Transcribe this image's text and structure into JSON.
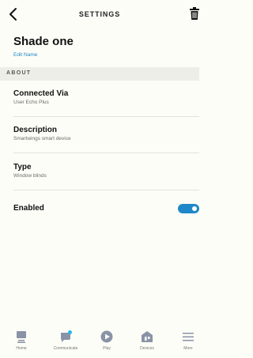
{
  "header": {
    "title": "SETTINGS",
    "back_icon": "back-arrow-icon",
    "delete_icon": "trash-icon"
  },
  "device": {
    "name": "Shade one",
    "edit_label": "Edit Name"
  },
  "section": {
    "title": "ABOUT"
  },
  "rows": [
    {
      "label": "Connected Via",
      "value": "User Echo Plus"
    },
    {
      "label": "Description",
      "value": "Smartwings smart device"
    },
    {
      "label": "Type",
      "value": "Window blinds"
    }
  ],
  "enabled": {
    "label": "Enabled",
    "on": true
  },
  "nav": [
    {
      "label": "Home",
      "icon": "home-icon"
    },
    {
      "label": "Communicate",
      "icon": "chat-icon"
    },
    {
      "label": "Play",
      "icon": "play-icon"
    },
    {
      "label": "Devices",
      "icon": "devices-icon"
    },
    {
      "label": "More",
      "icon": "menu-icon"
    }
  ],
  "colors": {
    "accent": "#1e88c8",
    "background": "#fdfdf7"
  }
}
